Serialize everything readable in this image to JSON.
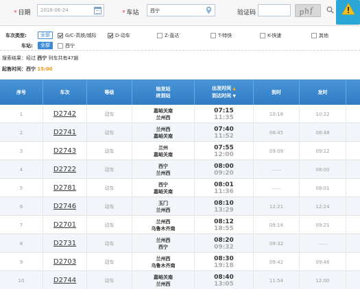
{
  "search": {
    "date_label": "日期",
    "date_value": "2016-06-24",
    "station_label": "车站",
    "station_value": "西宁",
    "captcha_label": "验证码",
    "captcha_text": "phf"
  },
  "filters": {
    "type_label": "车次类型:",
    "all_label": "全部",
    "types": [
      {
        "label": "G/C-高铁/城际",
        "checked": true
      },
      {
        "label": "D-动车",
        "checked": true
      },
      {
        "label": "Z-直达",
        "checked": false
      },
      {
        "label": "T-特快",
        "checked": false
      },
      {
        "label": "K-快速",
        "checked": false
      },
      {
        "label": "其他",
        "checked": false
      }
    ],
    "station_label": "车站:",
    "station_all_label": "全部",
    "station_option": "西宁"
  },
  "result": {
    "prefix": "搜索结果：经过",
    "station": "西宁",
    "suffix": "列车共有47趟"
  },
  "sale": {
    "label": "起售时间：西宁",
    "time": "15:00"
  },
  "table": {
    "headers": {
      "no": "序号",
      "train": "车次",
      "grade": "等级",
      "stations_1": "始发站",
      "stations_2": "终到站",
      "times_1": "出发时间",
      "times_2": "到达时间",
      "arrive": "到时",
      "depart": "发时"
    },
    "rows": [
      {
        "no": "1",
        "train": "D2742",
        "grade": "动车",
        "from": "嘉峪关南",
        "to": "兰州西",
        "dep": "07:15",
        "arr": "11:35",
        "at": "10:18",
        "dt": "10:22"
      },
      {
        "no": "2",
        "train": "D2741",
        "grade": "动车",
        "from": "兰州西",
        "to": "嘉峪关南",
        "dep": "07:40",
        "arr": "11:52",
        "at": "08:45",
        "dt": "08:48"
      },
      {
        "no": "3",
        "train": "D2743",
        "grade": "动车",
        "from": "兰州",
        "to": "嘉峪关南",
        "dep": "07:55",
        "arr": "12:00",
        "at": "09:09",
        "dt": "09:12"
      },
      {
        "no": "4",
        "train": "D2722",
        "grade": "动车",
        "from": "西宁",
        "to": "兰州西",
        "dep": "08:00",
        "arr": "09:20",
        "at": "——",
        "dt": "08:00"
      },
      {
        "no": "5",
        "train": "D2781",
        "grade": "动车",
        "from": "西宁",
        "to": "嘉峪关南",
        "dep": "08:01",
        "arr": "11:36",
        "at": "——",
        "dt": "08:01"
      },
      {
        "no": "6",
        "train": "D2746",
        "grade": "动车",
        "from": "玉门",
        "to": "兰州西",
        "dep": "08:10",
        "arr": "13:29",
        "at": "12:21",
        "dt": "12:24"
      },
      {
        "no": "7",
        "train": "D2701",
        "grade": "动车",
        "from": "兰州西",
        "to": "乌鲁木齐南",
        "dep": "08:12",
        "arr": "18:55",
        "at": "09:18",
        "dt": "09:21"
      },
      {
        "no": "8",
        "train": "D2731",
        "grade": "动车",
        "from": "兰州西",
        "to": "西宁",
        "dep": "08:20",
        "arr": "09:32",
        "at": "09:32",
        "dt": "——"
      },
      {
        "no": "9",
        "train": "D2703",
        "grade": "动车",
        "from": "兰州西",
        "to": "乌鲁木齐南",
        "dep": "08:30",
        "arr": "19:18",
        "at": "09:42",
        "dt": "09:46"
      },
      {
        "no": "10",
        "train": "D2744",
        "grade": "动车",
        "from": "嘉峪关南",
        "to": "兰州西",
        "dep": "08:40",
        "arr": "13:05",
        "at": "11:54",
        "dt": "12:00"
      }
    ]
  },
  "colors": {
    "header_blue": "#3a86cf",
    "link_blue": "#3d8ad6",
    "sale_orange": "#f09a16",
    "warn_yellow": "#f6c21b"
  }
}
